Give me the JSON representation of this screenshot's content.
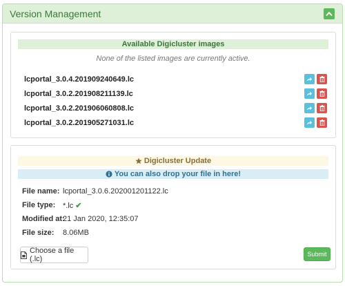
{
  "panel": {
    "title": "Version Management"
  },
  "images": {
    "header": "Available Digicluster images",
    "note": "None of the listed images are currently active.",
    "items": [
      {
        "name": "lcportal_3.0.4.201909240649.lc"
      },
      {
        "name": "lcportal_3.0.2.201908211139.lc"
      },
      {
        "name": "lcportal_3.0.2.201906060808.lc"
      },
      {
        "name": "lcportal_3.0.2.201905271031.lc"
      }
    ]
  },
  "update": {
    "header": "Digicluster Update",
    "drop_hint": "You can also drop your file in here!",
    "fields": [
      {
        "label": "File name:",
        "value": "lcportal_3.0.6.202001201122.lc"
      },
      {
        "label": "File type:",
        "value": "*.lc"
      },
      {
        "label": "Modified at:",
        "value": "21 Jan 2020, 12:35:07"
      },
      {
        "label": "File size:",
        "value": "8.06MB"
      }
    ],
    "choose_label": "Choose a file (.lc)",
    "submit_label": "Submit"
  },
  "icons": {
    "collapse": "chevron-up-icon",
    "share": "share-icon",
    "delete": "trash-icon",
    "star": "star-icon",
    "info": "info-circle-icon",
    "check": "check-icon",
    "file": "file-icon"
  },
  "colors": {
    "success": "#5cb85c",
    "info": "#5bc0de",
    "danger": "#d9534f",
    "panel_header_bg": "#dff0d8",
    "warning_bg": "#fcf8e3",
    "info_bg": "#d9edf7"
  }
}
